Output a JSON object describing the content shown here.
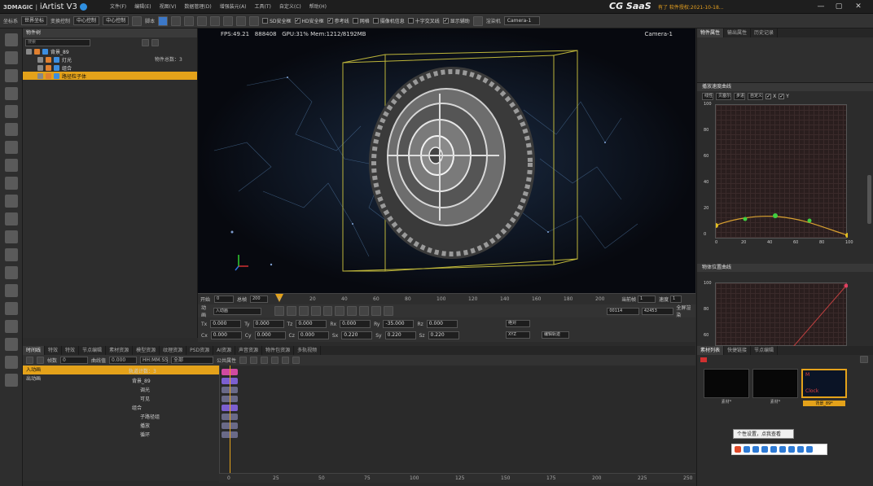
{
  "app": {
    "brand": "3DMAGIC",
    "name": "iArtist V3",
    "cg_logo": "CG SaaS",
    "license": "有了 软件授权:2021-10-18...",
    "colors": {
      "accent": "#e4a21a",
      "selection_blue": "#3c78c8",
      "keyframe_purple": "#7c5fd0",
      "keyframe_pink": "#d04aa0"
    }
  },
  "menu": [
    "文件(F)",
    "编辑(E)",
    "视图(V)",
    "数据管理(D)",
    "增强装元(A)",
    "工具(T)",
    "自定义(C)",
    "帮助(H)"
  ],
  "toolbar": {
    "left_labels": [
      "坐标系",
      "世界坐标",
      "变换控制",
      "中心控制",
      "中心控制"
    ],
    "script_label": "脚本",
    "checks": [
      "SD安全框",
      "HD安全框",
      "参考线",
      "网格",
      "摄像机信息",
      "十字交叉线",
      "显示辅助"
    ],
    "render_label": "渲染机",
    "camera_select": "Camera-1"
  },
  "object_panel": {
    "title": "物件树",
    "search_placeholder": "搜索",
    "count_label": "物件总数：",
    "count_value": "3",
    "tree": [
      {
        "label": "背景_89",
        "selected": false
      },
      {
        "label": "灯光",
        "selected": false
      },
      {
        "label": "组合",
        "selected": false
      },
      {
        "label": "路径粒子体",
        "selected": true
      }
    ]
  },
  "viewport": {
    "fps": "FPS:49.21",
    "tris": "888408",
    "gpu": "GPU:31% Mem:1212/8192MB",
    "camera": "Camera-1"
  },
  "vp_ruler": {
    "start_label": "开始",
    "start": "0",
    "length_label": "总帧",
    "length": "200",
    "ticks": [
      "0",
      "20",
      "40",
      "60",
      "80",
      "100",
      "120",
      "140",
      "160",
      "180",
      "200"
    ],
    "current_label": "当前帧",
    "current": "1",
    "speed_label": "速度",
    "speed": "1"
  },
  "vp_controls": {
    "anim_label": "动画",
    "anim_select": "入动画",
    "right_fields": [
      "00114",
      "42453"
    ],
    "right_label": "全屏渲染"
  },
  "transform": {
    "row1": [
      {
        "label": "Tx",
        "value": "0.000"
      },
      {
        "label": "Ty",
        "value": "0.000"
      },
      {
        "label": "Tz",
        "value": "0.000"
      },
      {
        "label": "Rx",
        "value": "0.000"
      },
      {
        "label": "Ry",
        "value": "-35.000"
      },
      {
        "label": "Rz",
        "value": "0.000"
      }
    ],
    "row2": [
      {
        "label": "Cx",
        "value": "0.000"
      },
      {
        "label": "Cy",
        "value": "0.000"
      },
      {
        "label": "Cz",
        "value": "0.000"
      },
      {
        "label": "Sx",
        "value": "0.220"
      },
      {
        "label": "Sy",
        "value": "0.220"
      },
      {
        "label": "Sz",
        "value": "0.220"
      }
    ],
    "order": "XYZ",
    "mode": "绝对",
    "reset": "编辑轨迹"
  },
  "right_panel": {
    "tabs": [
      "物件属性",
      "输出属性",
      "历史记录"
    ],
    "section1": "播放速度曲线",
    "section1_buttons": [
      "线性",
      "贝塞尔",
      "步进",
      "自定义"
    ],
    "section1_axes": [
      "X",
      "Y"
    ],
    "y_ticks_1": [
      "100",
      "80",
      "60",
      "40",
      "20",
      "0"
    ],
    "x_ticks_1": [
      "0",
      "20",
      "40",
      "60",
      "80",
      "100"
    ],
    "section2": "物体位置曲线",
    "y_ticks_2": [
      "100",
      "80",
      "60"
    ]
  },
  "bottom": {
    "tabs": [
      "时间线",
      "特效",
      "特效",
      "节点编辑",
      "素材资源",
      "模型资源",
      "纹理资源",
      "PSD资源",
      "AI资源",
      "声音资源",
      "物件包资源",
      "多轨视频"
    ],
    "toolbar": {
      "frame_label": "帧数",
      "frame_value": "0",
      "curve_label": "曲线值",
      "curve_value": "0.000",
      "dropdown": "全部",
      "property": "公共属性",
      "timecode": "HH:MM:SS"
    },
    "track_count_label": "轨道计数：3",
    "track_rows": [
      {
        "label": "入动画",
        "selected": true
      },
      {
        "label": "出动画",
        "selected": false
      }
    ],
    "track_items": [
      "背景_89",
      "调光",
      "可见",
      "组合",
      "子路径组",
      "播放",
      "循环"
    ],
    "timeline_ticks": [
      "0",
      "25",
      "50",
      "75",
      "100",
      "125",
      "150",
      "175",
      "200",
      "225",
      "250"
    ]
  },
  "materials": {
    "tabs": [
      "素材列表",
      "快捷链接",
      "节点编辑"
    ],
    "items": [
      {
        "name": "素材*",
        "selected": false
      },
      {
        "name": "素材*",
        "selected": false
      },
      {
        "name": "背景_89*",
        "selected": true
      }
    ],
    "thumb_labels": [
      "M",
      "Clock"
    ],
    "tooltip": "个性设置，点我查看"
  }
}
